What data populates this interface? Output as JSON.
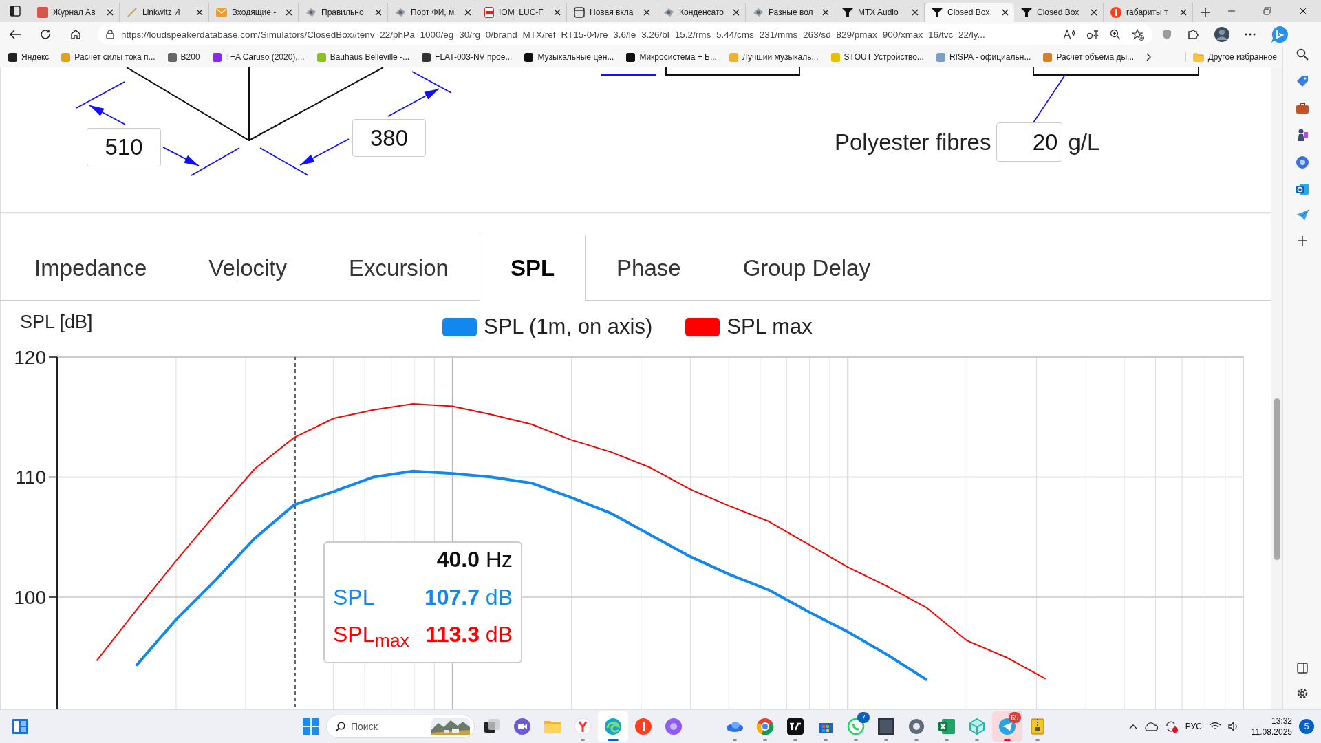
{
  "browser_tabs": [
    {
      "title": "Журнал Ав",
      "kind": "square",
      "selected": false
    },
    {
      "title": "Linkwitz И",
      "kind": "pen",
      "selected": false
    },
    {
      "title": "Входящие -",
      "kind": "mail",
      "selected": false
    },
    {
      "title": "Правильно",
      "kind": "site",
      "selected": false
    },
    {
      "title": "Порт ФИ, м",
      "kind": "site",
      "selected": false
    },
    {
      "title": "IOM_LUC-F",
      "kind": "pdf",
      "selected": false
    },
    {
      "title": "Новая вкла",
      "kind": "window",
      "selected": false
    },
    {
      "title": "Конденсато",
      "kind": "site",
      "selected": false
    },
    {
      "title": "Разные вол",
      "kind": "site",
      "selected": false
    },
    {
      "title": "MTX Audio",
      "kind": "speaker",
      "selected": false
    },
    {
      "title": "Closed Box",
      "kind": "speaker",
      "selected": true
    },
    {
      "title": "Closed Box",
      "kind": "speaker",
      "selected": false
    },
    {
      "title": "габариты т",
      "kind": "circle",
      "selected": false
    }
  ],
  "address_bar": {
    "url": "https://loudspeakerdatabase.com/Simulators/ClosedBox#tenv=22/phPa=1000/eg=30/rg=0/brand=MTX/ref=RT15-04/re=3.6/le=3.26/bl=15.2/rms=5.44/cms=231/mms=263/sd=829/pmax=900/xmax=16/tvc=22/ly..."
  },
  "bookmarks": [
    {
      "label": "Яндекс",
      "color": "#222222"
    },
    {
      "label": "Расчет силы тока п...",
      "color": "#e0a020"
    },
    {
      "label": "B200",
      "color": "#666666"
    },
    {
      "label": "T+A Caruso (2020),...",
      "color": "#8a2be2"
    },
    {
      "label": "Bauhaus Belleville -...",
      "color": "#8cc21f"
    },
    {
      "label": "FLAT-003-NV прое...",
      "color": "#333333"
    },
    {
      "label": "Музыкальные цен...",
      "color": "#111111"
    },
    {
      "label": "Микросистема + Б...",
      "color": "#111111"
    },
    {
      "label": "Лучший музыкаль...",
      "color": "#f0b030"
    },
    {
      "label": "STOUT Устройство...",
      "color": "#e8c000"
    },
    {
      "label": "RISPA - официальн...",
      "color": "#7aa0c8"
    },
    {
      "label": "Расчет объема ды...",
      "color": "#d08030"
    }
  ],
  "other_favorites": {
    "label": "Другое избранное"
  },
  "page": {
    "dimension_fields": [
      "510",
      "380"
    ],
    "filling": {
      "label": "Polyester fibres",
      "value": "20",
      "unit": "g/L"
    },
    "result_tabs": [
      {
        "label": "Impedance",
        "selected": false
      },
      {
        "label": "Velocity",
        "selected": false
      },
      {
        "label": "Excursion",
        "selected": false
      },
      {
        "label": "SPL",
        "selected": true
      },
      {
        "label": "Phase",
        "selected": false
      },
      {
        "label": "Group Delay",
        "selected": false
      }
    ],
    "chart": {
      "chart_data": {
        "type": "line",
        "ylabel": "SPL [dB]",
        "categories": [
          null,
          null,
          null,
          null,
          null,
          null,
          null,
          null,
          null,
          null,
          null,
          null,
          null,
          null,
          null,
          null,
          null,
          null,
          null,
          null,
          null,
          null,
          null,
          null,
          null,
          null,
          null,
          null,
          null,
          null,
          null
        ],
        "series": [
          {
            "name": "SPL (1m, on axis)",
            "color": "#1288ee",
            "values": [
              null,
              null,
              94.3,
              98.1,
              101.4,
              104.9,
              107.7,
              108.8,
              110,
              110.5,
              110.3,
              110,
              109.5,
              108.3,
              107,
              105.2,
              103.4,
              101.9,
              100.6,
              98.8,
              97.1,
              95.2,
              93.1,
              null,
              null,
              null,
              null,
              null,
              null,
              null,
              null
            ]
          },
          {
            "name": "SPL max",
            "color": "#ff0000",
            "values": [
              null,
              94.7,
              98.9,
              103,
              106.9,
              110.7,
              113.3,
              114.9,
              115.6,
              116.1,
              115.9,
              115.2,
              114.4,
              113.1,
              112.1,
              110.8,
              109,
              107.6,
              106.3,
              104.4,
              102.5,
              100.9,
              99.1,
              96.4,
              95,
              93.2,
              null,
              null,
              null,
              null,
              null
            ]
          }
        ],
        "ylim": [
          90.6,
          120
        ],
        "yticks": [
          100,
          110,
          120
        ],
        "grid": true
      },
      "tooltip": {
        "frequency": "40.0",
        "frequency_unit": "Hz",
        "rows": [
          {
            "kind": "spl",
            "label": "SPL",
            "value": "107.7",
            "unit": "dB"
          },
          {
            "kind": "max",
            "label": "SPL$_{max}$",
            "value": "113.3",
            "unit": "dB"
          }
        ]
      }
    }
  },
  "taskbar": {
    "search": {
      "placeholder": "Поиск"
    },
    "apps": [
      {
        "kind": "squares",
        "running": false,
        "active": false,
        "flashing": false
      },
      {
        "kind": "video",
        "running": false,
        "active": false,
        "flashing": false
      },
      {
        "kind": "folder",
        "running": false,
        "active": false,
        "flashing": false
      },
      {
        "kind": "ybrowser",
        "running": true,
        "active": false,
        "flashing": false
      },
      {
        "kind": "wave",
        "running": true,
        "active": true,
        "flashing": false
      },
      {
        "kind": "redcircle",
        "running": false,
        "active": false,
        "flashing": false
      },
      {
        "kind": "ring",
        "running": false,
        "active": false,
        "flashing": false
      },
      {
        "kind": "cloud",
        "running": true,
        "active": false,
        "flashing": false
      },
      {
        "kind": "wheel",
        "running": true,
        "active": false,
        "flashing": false
      },
      {
        "kind": "darksquare",
        "running": true,
        "active": false,
        "flashing": false
      },
      {
        "kind": "store",
        "running": true,
        "active": false,
        "flashing": false
      },
      {
        "kind": "phone",
        "running": true,
        "active": false,
        "flashing": false,
        "badge": "7"
      },
      {
        "kind": "tile",
        "running": true,
        "active": false,
        "flashing": false
      },
      {
        "kind": "gear",
        "running": true,
        "active": false,
        "flashing": false
      },
      {
        "kind": "sheet",
        "running": true,
        "active": false,
        "flashing": false
      },
      {
        "kind": "cube",
        "running": true,
        "active": false,
        "flashing": false
      },
      {
        "kind": "plane",
        "running": true,
        "active": false,
        "flashing": true,
        "badge": "69"
      },
      {
        "kind": "archive",
        "running": true,
        "active": false,
        "flashing": false
      }
    ],
    "tray": {
      "language": "РУС",
      "time": "13:32",
      "date": "11.08.2025",
      "notifications": "5"
    }
  }
}
